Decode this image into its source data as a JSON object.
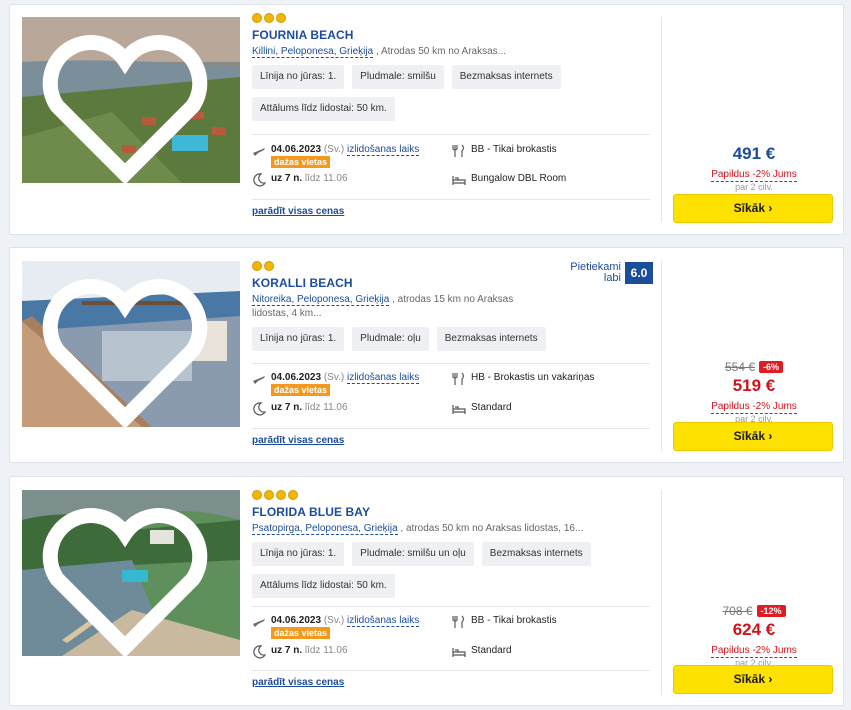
{
  "colors": {
    "accent": "#1b4d9c",
    "price_red": "#d3131c",
    "button": "#ffe100",
    "badge": "#f39a1e",
    "discount": "#e21b23"
  },
  "hotels": [
    {
      "stars": 3,
      "name": "FOURNIA BEACH",
      "location_place": "Killini, Peloponesa, Grieķija",
      "location_rest": " , Atrodas  50 km no Araksas...",
      "tags": [
        "Līnija no jūras: 1.",
        "Pludmale: smilšu",
        "Bezmaksas internets",
        "Attālums līdz lidostai: 50 km."
      ],
      "date": "04.06.2023",
      "day": "(Sv.)",
      "departure": "izlidošanas laiks",
      "badge": "dažas vietas",
      "nights": "uz 7 n.",
      "until": "līdz 11.06",
      "board": "BB - Tikai brokastis",
      "room": "Bungalow DBL Room",
      "all_prices": "parādīt visas cenas",
      "old_price": "",
      "discount": "",
      "price": "491 €",
      "extra": "Papildus -2% Jums",
      "per": "par 2 cilv.",
      "rating_text": "",
      "rating_score": "",
      "button": "Sīkāk ›"
    },
    {
      "stars": 2,
      "name": "KORALLI BEACH",
      "location_place": "Nitoreika, Peloponesa, Grieķija",
      "location_rest": " , atrodas 15 km no Araksas lidostas, 4 km...",
      "tags": [
        "Līnija no jūras: 1.",
        "Pludmale: oļu",
        "Bezmaksas internets"
      ],
      "date": "04.06.2023",
      "day": "(Sv.)",
      "departure": "izlidošanas laiks",
      "badge": "dažas vietas",
      "nights": "uz 7 n.",
      "until": "līdz 11.06",
      "board": "HB - Brokastis un vakariņas",
      "room": "Standard",
      "all_prices": "parādīt visas cenas",
      "old_price": "554 €",
      "discount": "-6%",
      "price": "519 €",
      "extra": "Papildus -2% Jums",
      "per": "par 2 cilv.",
      "rating_text": "Pietiekami labi",
      "rating_score": "6.0",
      "button": "Sīkāk ›"
    },
    {
      "stars": 4,
      "name": "FLORIDA BLUE BAY",
      "location_place": "Psatopirga, Peloponesa, Grieķija",
      "location_rest": " , atrodas 50 km no Araksas lidostas, 16...",
      "tags": [
        "Līnija no jūras: 1.",
        "Pludmale: smilšu un oļu",
        "Bezmaksas internets",
        "Attālums līdz lidostai: 50 km."
      ],
      "date": "04.06.2023",
      "day": "(Sv.)",
      "departure": "izlidošanas laiks",
      "badge": "dažas vietas",
      "nights": "uz 7 n.",
      "until": "līdz 11.06",
      "board": "BB - Tikai brokastis",
      "room": "Standard",
      "all_prices": "parādīt visas cenas",
      "old_price": "708 €",
      "discount": "-12%",
      "price": "624 €",
      "extra": "Papildus -2% Jums",
      "per": "par 2 cilv.",
      "rating_text": "",
      "rating_score": "",
      "button": "Sīkāk ›"
    }
  ]
}
